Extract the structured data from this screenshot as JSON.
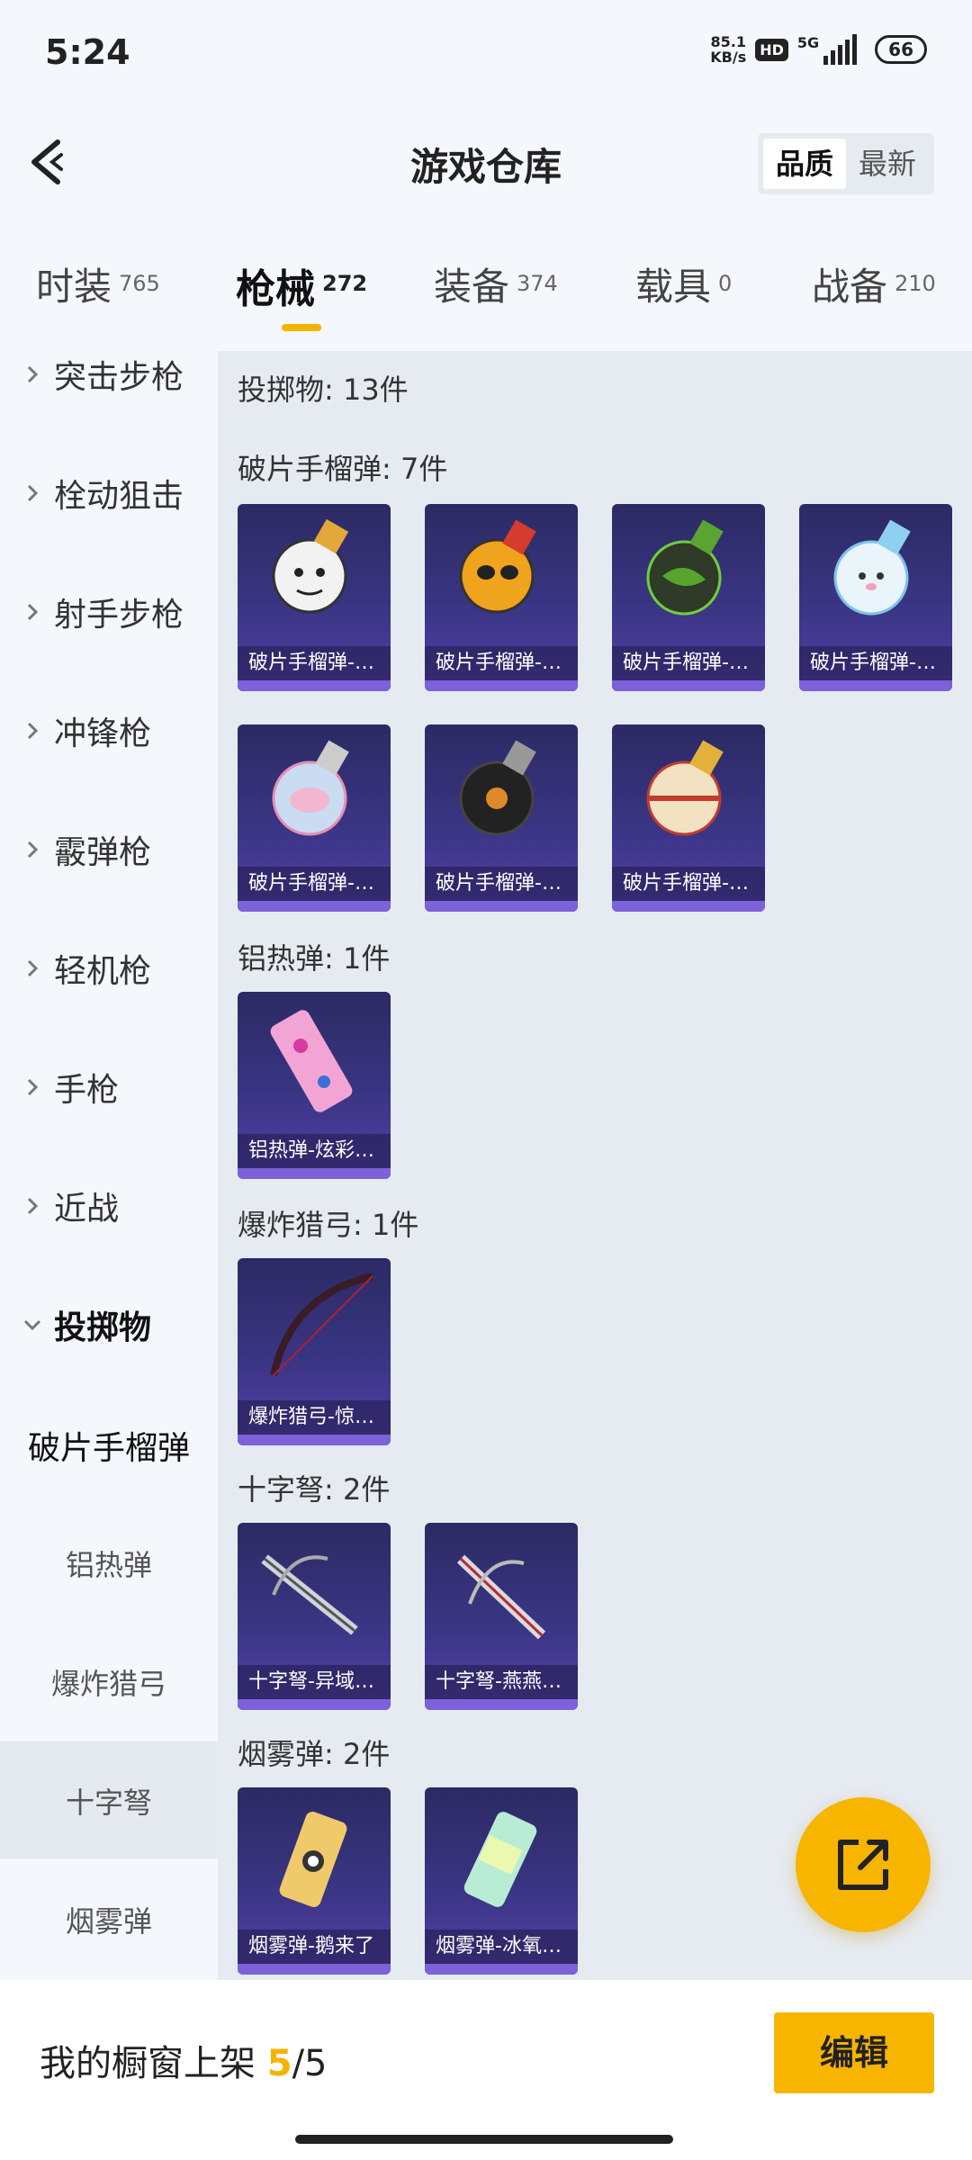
{
  "status": {
    "time": "5:24",
    "net_speed": "85.1",
    "net_unit": "KB/s",
    "hd": "HD",
    "signal": "5G",
    "battery": "66"
  },
  "header": {
    "title": "游戏仓库",
    "sort_quality": "品质",
    "sort_latest": "最新"
  },
  "tabs": [
    {
      "name": "时装",
      "count": "765"
    },
    {
      "name": "枪械",
      "count": "272"
    },
    {
      "name": "装备",
      "count": "374"
    },
    {
      "name": "载具",
      "count": "0"
    },
    {
      "name": "战备",
      "count": "210"
    }
  ],
  "sidebar": {
    "categories": [
      "突击步枪",
      "栓动狙击",
      "射手步枪",
      "冲锋枪",
      "霰弹枪",
      "轻机枪",
      "手枪",
      "近战",
      "投掷物"
    ],
    "subcategories": [
      "破片手榴弹",
      "铝热弹",
      "爆炸猎弓",
      "十字弩",
      "烟雾弹"
    ]
  },
  "content": {
    "total": "投掷物: 13件",
    "sections": [
      {
        "title": "破片手榴弹: 7件",
        "items": [
          "破片手榴弹-…",
          "破片手榴弹-…",
          "破片手榴弹-…",
          "破片手榴弹-…",
          "破片手榴弹-…",
          "破片手榴弹-…",
          "破片手榴弹-…"
        ]
      },
      {
        "title": "铝热弹: 1件",
        "items": [
          "铝热弹-炫彩…"
        ]
      },
      {
        "title": "爆炸猎弓: 1件",
        "items": [
          "爆炸猎弓-惊…"
        ]
      },
      {
        "title": "十字弩: 2件",
        "items": [
          "十字弩-异域…",
          "十字弩-燕燕…"
        ]
      },
      {
        "title": "烟雾弹: 2件",
        "items": [
          "烟雾弹-鹅来了",
          "烟雾弹-冰氧…"
        ]
      }
    ]
  },
  "bottom": {
    "shelf_label": "我的橱窗上架",
    "shelf_current": "5",
    "shelf_sep": "/",
    "shelf_total": "5",
    "edit_label": "编辑"
  },
  "colors": {
    "accent": "#f7b500",
    "card_bg": "#3a3584",
    "card_bar": "#7c61d8"
  }
}
